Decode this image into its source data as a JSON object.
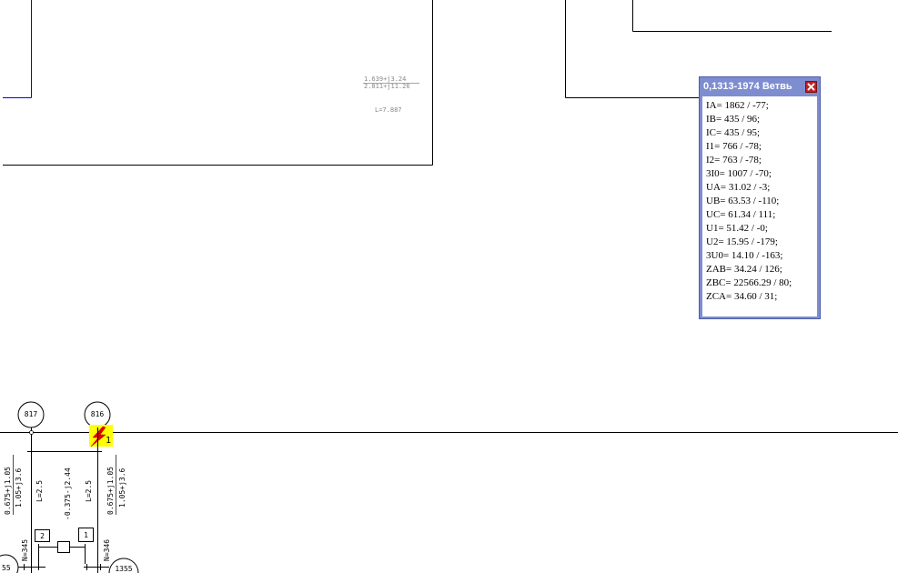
{
  "schema": {
    "upper_label_impedance_top": "1.639+j3.24",
    "upper_label_impedance_bottom": "2.811+j11.26",
    "upper_label_length": "L=7.887",
    "node_817": "817",
    "node_816": "816",
    "node_partial_left": "55",
    "node_partial_right": "1355",
    "fault_marker_number": "1",
    "left_branch_z1": "0.675+j1.05",
    "left_branch_z0": "1.05+j3.6",
    "left_branch_length": "L=2.5",
    "middle_branch_z": "-0.375-j2.44",
    "right_branch_length": "L=2.5",
    "right_branch_z1": "0.675+j1.05",
    "right_branch_z0": "1.05+j3.6",
    "left_breaker_number": "2",
    "right_breaker_number": "1",
    "left_line_number": "N=345",
    "right_line_number": "N=346"
  },
  "popup": {
    "title": "0,1313-1974 Ветвь",
    "lines": [
      "IA= 1862 / -77;",
      "IB= 435 / 96;",
      "IC= 435 / 95;",
      "I1= 766 / -78;",
      "I2= 763 / -78;",
      "3I0= 1007 / -70;",
      "UA= 31.02 / -3;",
      "UB= 63.53 / -110;",
      "UC= 61.34 / 111;",
      "U1= 51.42 / -0;",
      "U2= 15.95 / -179;",
      "3U0= 14.10 / -163;",
      "ZAB= 34.24 / 126;",
      "ZBC= 22566.29 / 80;",
      "ZCA= 34.60 / 31;"
    ]
  },
  "colors": {
    "popup_frame": "#7d8dd0",
    "fault_marker_bg": "#ffff00",
    "fault_bolt": "#e00000",
    "upper_left_line": "#0000ff"
  }
}
